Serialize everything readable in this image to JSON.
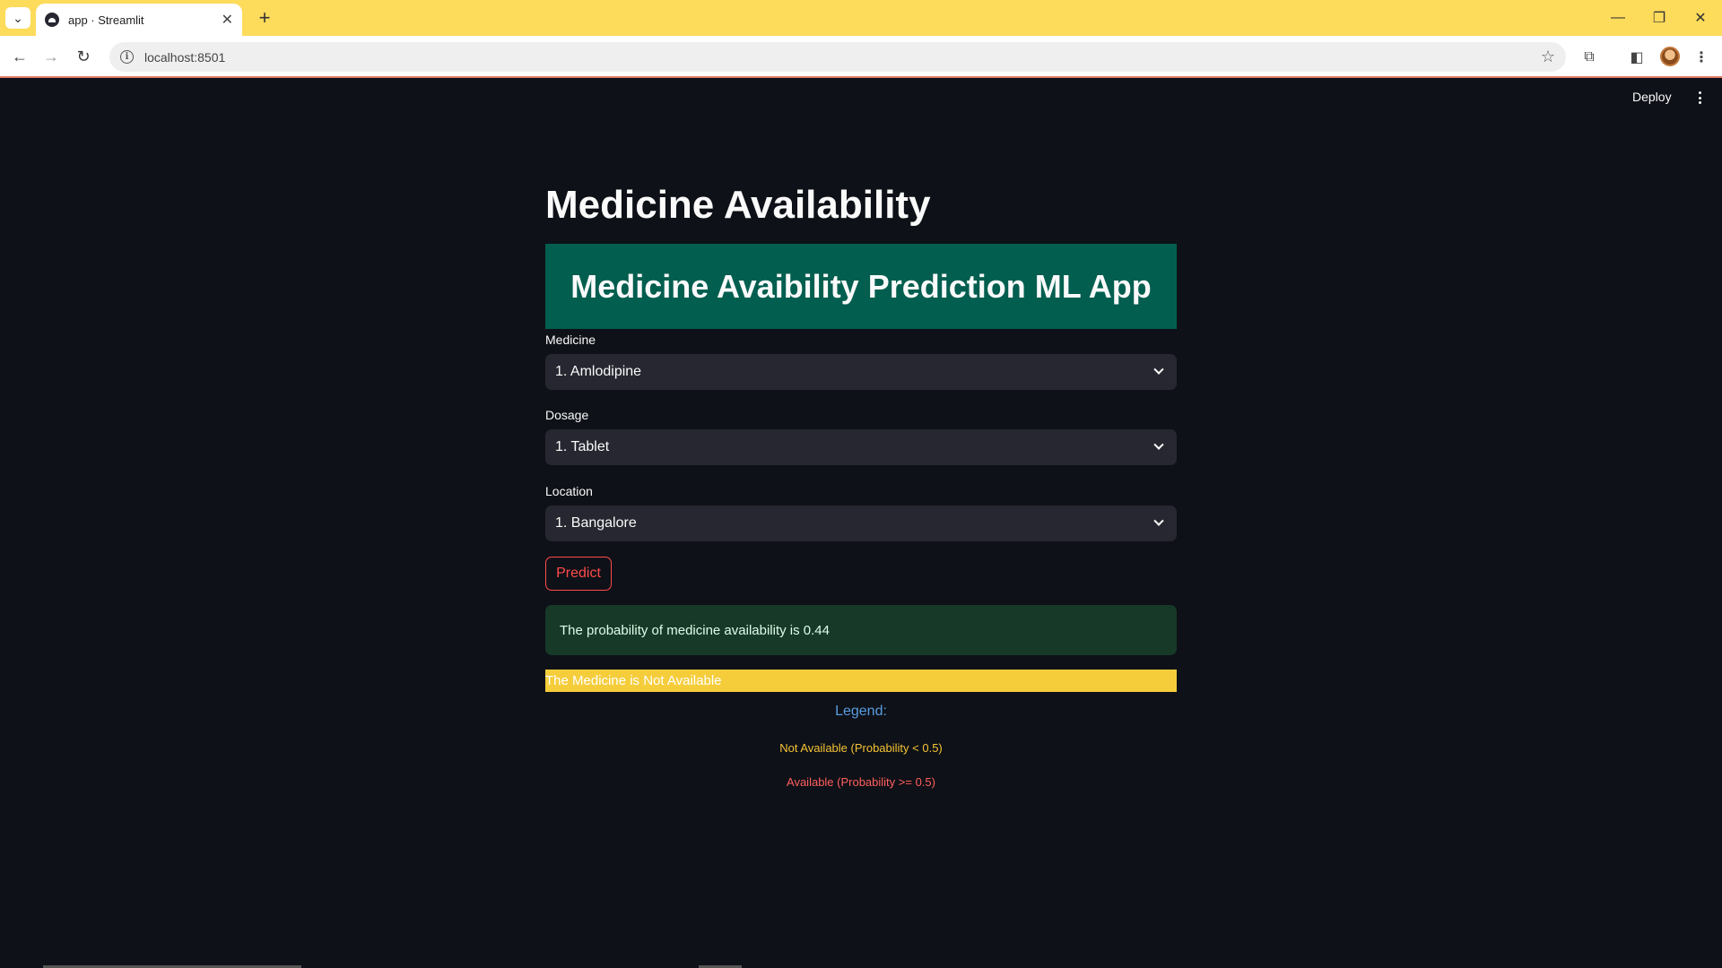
{
  "browser": {
    "tab_title": "app · Streamlit",
    "url": "localhost:8501"
  },
  "app_header": {
    "deploy_label": "Deploy"
  },
  "page": {
    "title": "Medicine Availability",
    "banner": "Medicine Avaibility Prediction ML App"
  },
  "form": {
    "medicine": {
      "label": "Medicine",
      "value": "1. Amlodipine"
    },
    "dosage": {
      "label": "Dosage",
      "value": "1. Tablet"
    },
    "location": {
      "label": "Location",
      "value": "1. Bangalore"
    },
    "predict_label": "Predict"
  },
  "result": {
    "probability_text": "The probability of medicine availability is 0.44",
    "status_text": "The Medicine is Not Available",
    "status_color": "#f5cd3b"
  },
  "legend": {
    "title": "Legend:",
    "not_available": "Not Available (Probability < 0.5)",
    "available": "Available (Probability >= 0.5)",
    "not_available_color": "#f6c336",
    "available_color": "#ff5f5f"
  },
  "colors": {
    "background": "#0e1117",
    "banner": "#025e4f",
    "accent": "#ff4b4b",
    "browser_frame": "#fddb5b"
  }
}
